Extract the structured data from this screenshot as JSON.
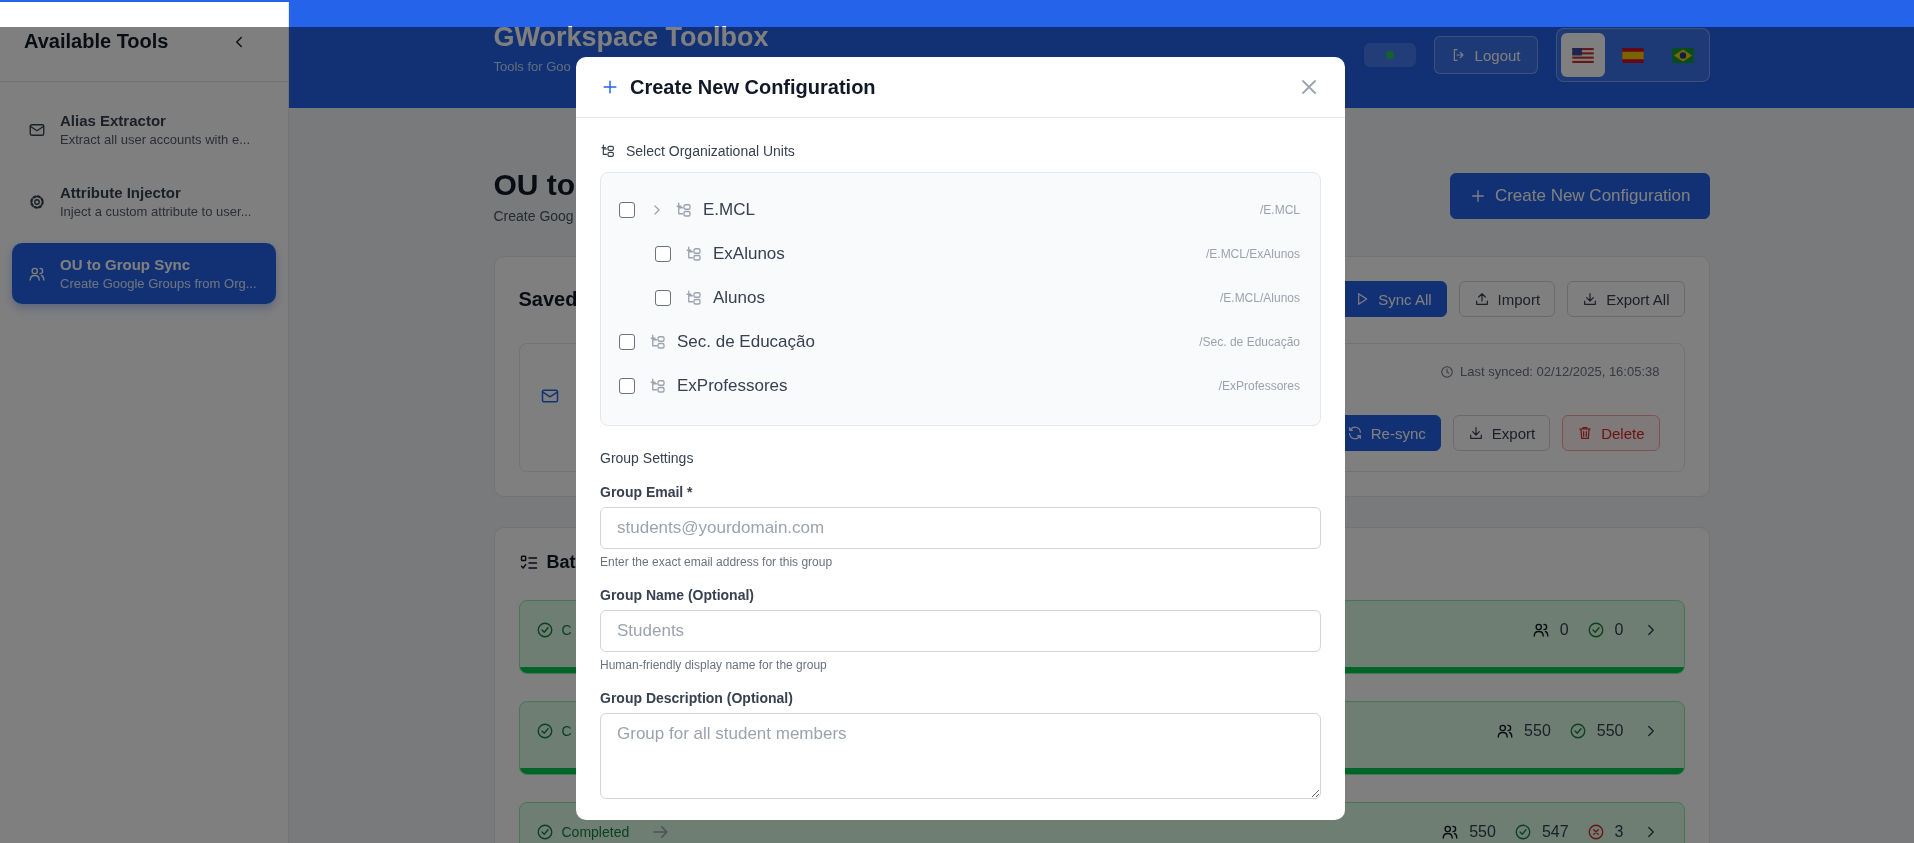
{
  "sidebar": {
    "title": "Available Tools",
    "items": [
      {
        "kind": "mail",
        "title": "Alias Extractor",
        "description": "Extract all user accounts with e...",
        "selected": false
      },
      {
        "kind": "gear",
        "title": "Attribute Injector",
        "description": "Inject a custom attribute to user...",
        "selected": false
      },
      {
        "kind": "users",
        "title": "OU to Group Sync",
        "description": "Create Google Groups from Org...",
        "selected": true
      }
    ]
  },
  "header": {
    "title": "GWorkspace Toolbox",
    "subtitle": "Tools for Goo",
    "logout": "Logout",
    "languages": [
      {
        "kind": "us",
        "selected": true
      },
      {
        "kind": "es",
        "selected": false
      },
      {
        "kind": "br",
        "selected": false
      }
    ]
  },
  "page": {
    "title": "OU to",
    "subtitle": "Create Goog",
    "create_button": "Create New Configuration"
  },
  "saved": {
    "title": "Saved",
    "actions": [
      {
        "kind": "sync",
        "label": "Sync All"
      },
      {
        "kind": "import",
        "label": "Import"
      },
      {
        "kind": "export",
        "label": "Export All"
      }
    ],
    "config": {
      "last_synced": "Last synced: 02/12/2025, 16:05:38",
      "actions": [
        {
          "kind": "resync",
          "label": "Re-sync"
        },
        {
          "kind": "export",
          "label": "Export"
        },
        {
          "kind": "delete",
          "label": "Delete"
        }
      ]
    }
  },
  "batch": {
    "title": "Bat",
    "rows": [
      {
        "status": "C",
        "users": "0",
        "succeeded": "0",
        "level": 1
      },
      {
        "status": "C",
        "users": "550",
        "succeeded": "550",
        "level": 1
      },
      {
        "status": "Completed",
        "users": "550",
        "succeeded": "547",
        "failed": "3"
      }
    ]
  },
  "modal": {
    "title": "Create New Configuration",
    "ou_label": "Select Organizational Units",
    "ous": [
      {
        "name": "E.MCL",
        "path": "/E.MCL",
        "checked": false,
        "children": [
          {
            "name": "ExAlunos",
            "path": "/E.MCL/ExAlunos",
            "checked": false
          },
          {
            "name": "Alunos",
            "path": "/E.MCL/Alunos",
            "checked": false
          }
        ]
      },
      {
        "name": "Sec. de Educação",
        "path": "/Sec. de Educação",
        "checked": false
      },
      {
        "name": "ExProfessores",
        "path": "/ExProfessores",
        "checked": false
      }
    ],
    "settings_title": "Group Settings",
    "fields": [
      {
        "kind": "input",
        "label": "Group Email *",
        "placeholder": "students@yourdomain.com",
        "hint": "Enter the exact email address for this group"
      },
      {
        "kind": "input",
        "label": "Group Name (Optional)",
        "placeholder": "Students",
        "hint": "Human-friendly display name for the group"
      },
      {
        "kind": "textarea",
        "label": "Group Description (Optional)",
        "placeholder": "Group for all student members"
      }
    ]
  }
}
